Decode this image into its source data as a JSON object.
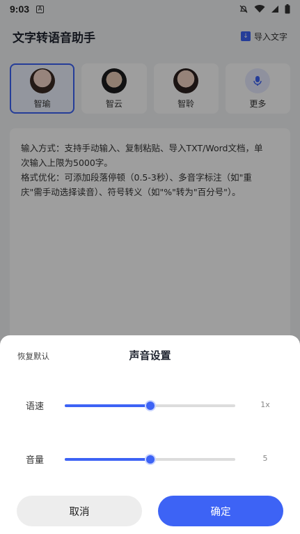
{
  "status_bar": {
    "time": "9:03",
    "notif_icon": "A"
  },
  "header": {
    "title": "文字转语音助手",
    "import_label": "导入文字"
  },
  "voices": [
    {
      "name": "智瑜",
      "avatar": "female-avatar-1",
      "selected": true
    },
    {
      "name": "智云",
      "avatar": "male-avatar-1",
      "selected": false
    },
    {
      "name": "智聆",
      "avatar": "female-avatar-2",
      "selected": false
    },
    {
      "name": "更多",
      "avatar": "mic-icon",
      "selected": false
    }
  ],
  "editor": {
    "lines": [
      "输入方式：支持手动输入、复制粘贴、导入TXT/Word文档，单",
      "次输入上限为5000字。",
      "格式优化：可添加段落停顿（0.5-3秒）、多音字标注（如\"重",
      "庆\"需手动选择读音）、符号转义（如\"%\"转为\"百分号\"）。"
    ]
  },
  "sheet": {
    "reset_label": "恢复默认",
    "title": "声音设置",
    "speed": {
      "label": "语速",
      "value_text": "1x",
      "level": 0.5
    },
    "volume": {
      "label": "音量",
      "value_text": "5",
      "level": 0.5
    },
    "cancel_label": "取消",
    "confirm_label": "确定"
  },
  "colors": {
    "accent": "#3d63f5",
    "track": "#dcdcdc",
    "overlay": "rgba(0,0,0,0.38)"
  }
}
